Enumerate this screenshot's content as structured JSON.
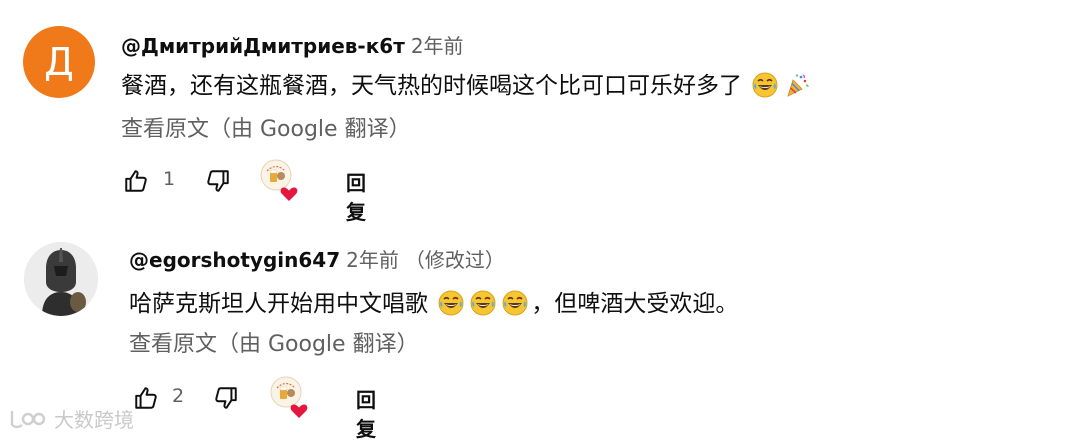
{
  "comments": [
    {
      "avatar_letter": "Д",
      "author": "@ДмитрийДмитриев-к6т",
      "time": "2年前",
      "edited": "",
      "text": "餐酒，还有这瓶餐酒，天气热的时候喝这个比可口可乐好多了",
      "emojis": [
        "laughing-tears-emoji",
        "party-popper-emoji"
      ],
      "translate_label": "查看原文（由 Google 翻译）",
      "like_count": "1",
      "reply_label": "回复"
    },
    {
      "author": "@egorshotygin647",
      "time": "2年前",
      "edited": "（修改过）",
      "text_before": "哈萨克斯坦人开始用中文唱歌",
      "text_after": "，但啤酒大受欢迎。",
      "emojis": [
        "laughing-tears-emoji",
        "laughing-tears-emoji",
        "laughing-tears-emoji"
      ],
      "translate_label": "查看原文（由 Google 翻译）",
      "like_count": "2",
      "reply_label": "回复"
    }
  ],
  "watermark": {
    "text": "大数跨境"
  },
  "colors": {
    "avatar_orange": "#f07a1a",
    "secondary_text": "#606060",
    "heart_red": "#e5173f"
  }
}
